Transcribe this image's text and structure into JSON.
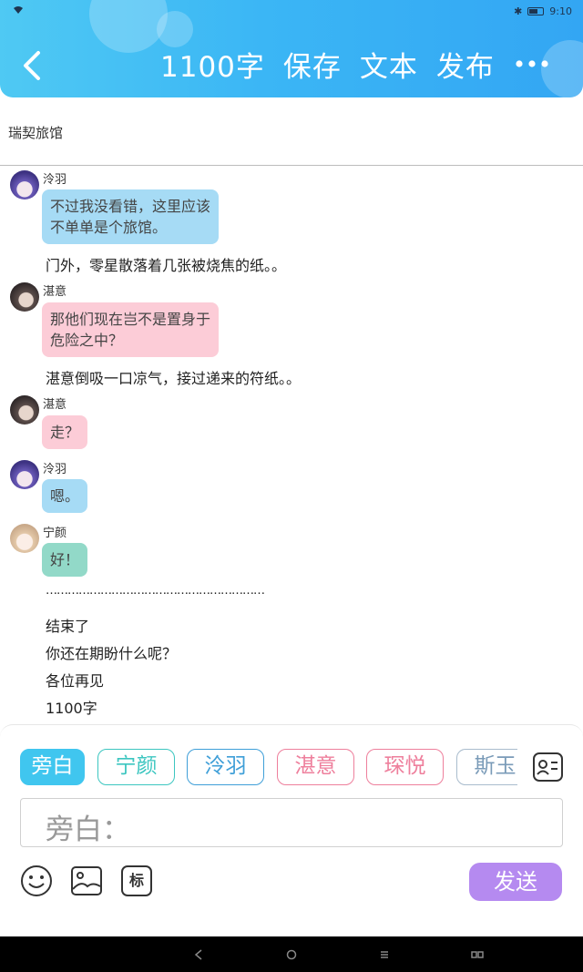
{
  "status_bar": {
    "time": "9:10"
  },
  "header": {
    "word_count": "1100字",
    "save_label": "保存",
    "text_label": "文本",
    "publish_label": "发布",
    "icons": {
      "back": "chevron-left-icon",
      "more": "more-dots-icon"
    }
  },
  "chapter": {
    "title": "瑞契旅馆"
  },
  "messages": [
    {
      "type": "dialogue",
      "speaker": "泠羽",
      "lines": [
        "不过我没看错，这里应该",
        "不单单是个旅馆。"
      ],
      "color": "#a6dbf5"
    },
    {
      "type": "narration",
      "text": "门外，零星散落着几张被烧焦的纸。。"
    },
    {
      "type": "dialogue",
      "speaker": "湛意",
      "lines": [
        "那他们现在岂不是置身于",
        "危险之中？"
      ],
      "color": "#fcccd7"
    },
    {
      "type": "narration",
      "text": "湛意倒吸一口凉气，接过递来的符纸。。"
    },
    {
      "type": "dialogue",
      "speaker": "湛意",
      "lines": [
        "走？"
      ],
      "color": "#fcccd7"
    },
    {
      "type": "dialogue",
      "speaker": "泠羽",
      "lines": [
        "嗯。"
      ],
      "color": "#a6dbf5"
    },
    {
      "type": "dialogue",
      "speaker": "宁颜",
      "lines": [
        "好！"
      ],
      "color": "#92d9c8"
    },
    {
      "type": "narration",
      "text": "……………………………………………………"
    },
    {
      "type": "narration",
      "text": "结束了"
    },
    {
      "type": "narration",
      "text": "你还在期盼什么呢？"
    },
    {
      "type": "narration",
      "text": "各位再见"
    },
    {
      "type": "narration",
      "text": "1100字"
    }
  ],
  "role_chips": [
    {
      "label": "旁白",
      "color": "#40c6ef",
      "active": true
    },
    {
      "label": "宁颜",
      "color": "#3cc6c0",
      "active": false
    },
    {
      "label": "泠羽",
      "color": "#3f9fd8",
      "active": false
    },
    {
      "label": "湛意",
      "color": "#ee7f9c",
      "active": false
    },
    {
      "label": "琛悦",
      "color": "#ee7f9c",
      "active": false
    },
    {
      "label": "斯玉",
      "color": "#7a9bb8",
      "active": false
    }
  ],
  "input": {
    "placeholder": "旁白："
  },
  "toolbar": {
    "send_label": "发送",
    "tag_label": "标",
    "icons": {
      "emoji": "smiley-icon",
      "image": "image-icon",
      "tag": "tag-icon",
      "contacts": "contact-card-icon"
    }
  },
  "nav_bar": {
    "icons": [
      "back-triangle-icon",
      "home-circle-icon",
      "menu-icon",
      "recents-icon"
    ]
  }
}
